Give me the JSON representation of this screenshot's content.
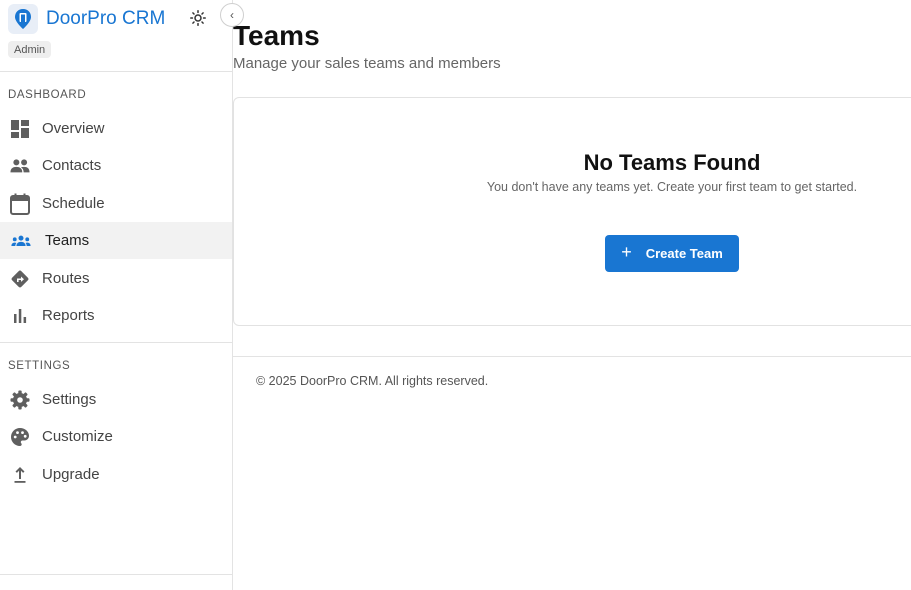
{
  "brand": {
    "name": "DoorPro CRM",
    "role_badge": "Admin",
    "accent": "#1976d2"
  },
  "sidebar": {
    "sections": [
      {
        "title": "DASHBOARD"
      },
      {
        "title": "SETTINGS"
      }
    ],
    "items": [
      {
        "label": "Overview",
        "icon": "dashboard-icon"
      },
      {
        "label": "Contacts",
        "icon": "people-icon"
      },
      {
        "label": "Schedule",
        "icon": "calendar-icon"
      },
      {
        "label": "Teams",
        "icon": "groups-icon",
        "active": true
      },
      {
        "label": "Routes",
        "icon": "directions-icon"
      },
      {
        "label": "Reports",
        "icon": "bar-chart-icon"
      },
      {
        "label": "Settings",
        "icon": "gear-icon"
      },
      {
        "label": "Customize",
        "icon": "palette-icon"
      },
      {
        "label": "Upgrade",
        "icon": "upload-icon"
      }
    ]
  },
  "main": {
    "title": "Teams",
    "subtitle": "Manage your sales teams and members",
    "empty_state": {
      "title": "No Teams Found",
      "text": "You don't have any teams yet. Create your first team to get started.",
      "button_label": "Create Team"
    }
  },
  "footer": {
    "text": "© 2025 DoorPro CRM. All rights reserved."
  }
}
